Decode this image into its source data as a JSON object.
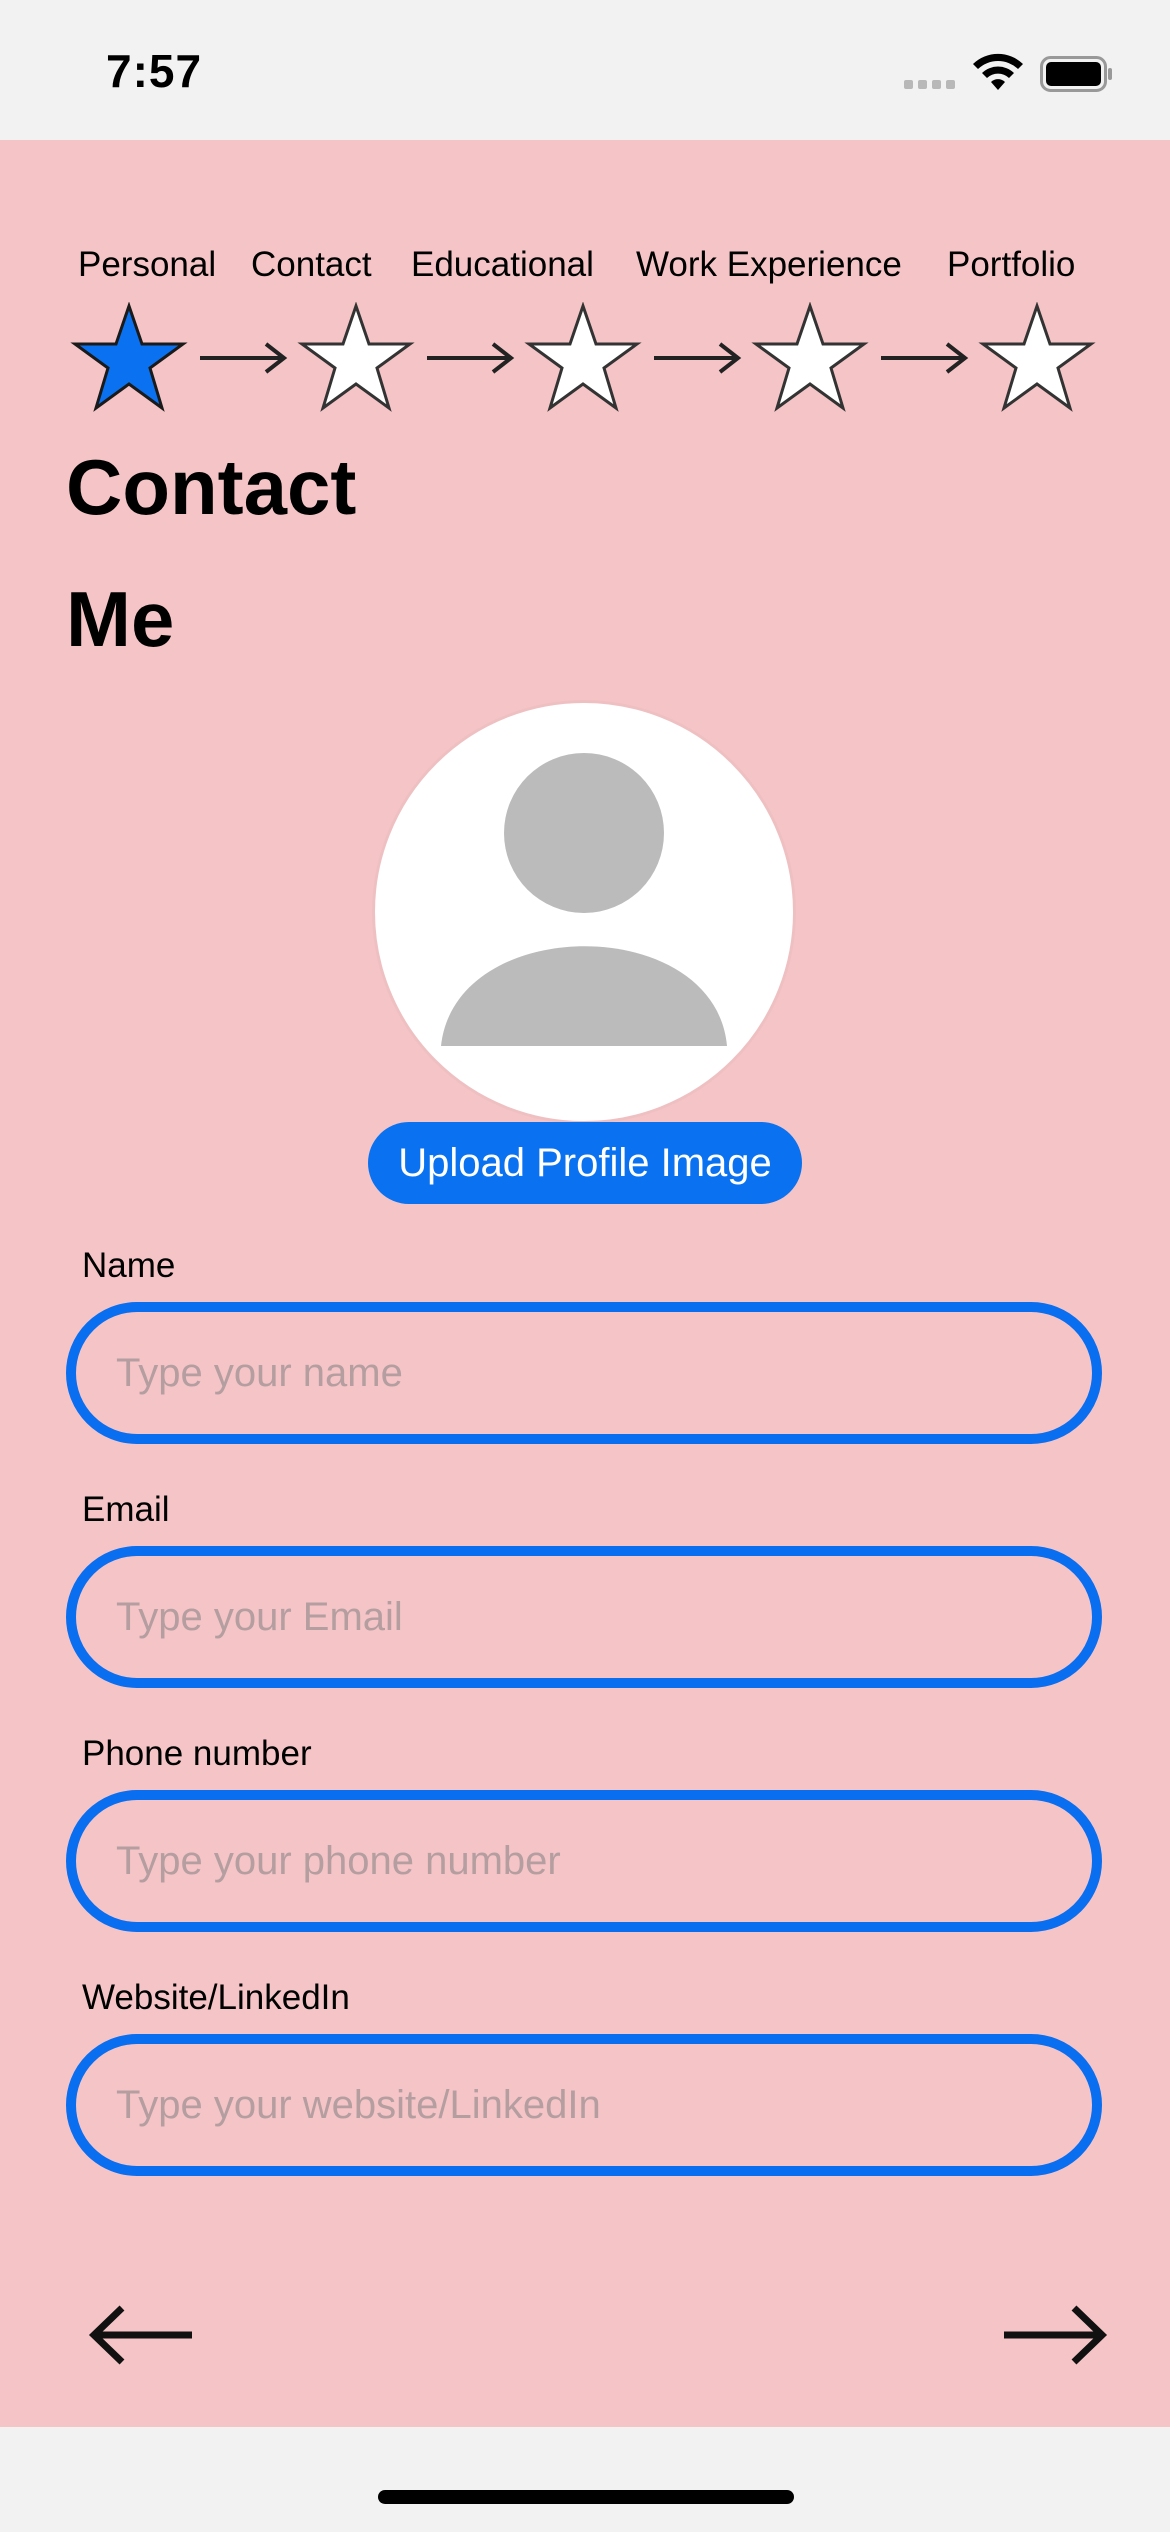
{
  "status_bar": {
    "time": "7:57"
  },
  "steps": [
    {
      "label": "Personal",
      "active": true
    },
    {
      "label": "Contact",
      "active": false
    },
    {
      "label": "Educational",
      "active": false
    },
    {
      "label": "Work Experience",
      "active": false
    },
    {
      "label": "Portfolio",
      "active": false
    }
  ],
  "page": {
    "title_line1": "Contact",
    "title_line2": "Me"
  },
  "profile": {
    "upload_label": "Upload Profile Image"
  },
  "form": {
    "name": {
      "label": "Name",
      "placeholder": "Type your name",
      "value": ""
    },
    "email": {
      "label": "Email",
      "placeholder": "Type your Email",
      "value": ""
    },
    "phone": {
      "label": "Phone number",
      "placeholder": "Type your phone number",
      "value": ""
    },
    "website": {
      "label": "Website/LinkedIn",
      "placeholder": "Type your website/LinkedIn",
      "value": ""
    }
  },
  "navigation": {
    "back": "arrow-left-icon",
    "next": "arrow-right-icon"
  },
  "colors": {
    "background": "#f5c4c7",
    "accent": "#0a72f0",
    "star_active": "#0a72f0",
    "star_inactive": "#ffffff"
  }
}
